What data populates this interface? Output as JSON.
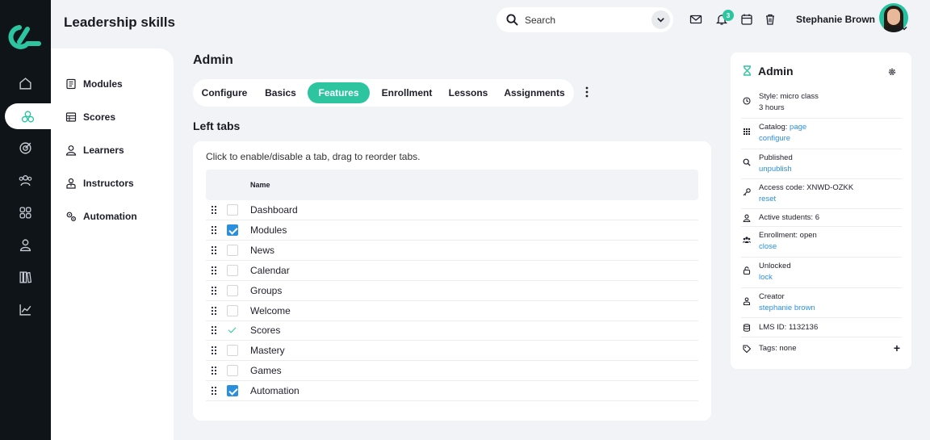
{
  "app": {
    "title": "Leadership skills"
  },
  "header": {
    "search_label": "Search",
    "notification_count": "3",
    "user_name": "Stephanie Brown"
  },
  "subnav": {
    "items": [
      {
        "label": "Modules",
        "icon": "book-icon"
      },
      {
        "label": "Scores",
        "icon": "table-icon"
      },
      {
        "label": "Learners",
        "icon": "user-icon"
      },
      {
        "label": "Instructors",
        "icon": "instructor-icon"
      },
      {
        "label": "Automation",
        "icon": "cogs-icon"
      }
    ]
  },
  "main": {
    "section_title": "Admin",
    "tabs": [
      {
        "label": "Configure"
      },
      {
        "label": "Basics"
      },
      {
        "label": "Features",
        "active": true
      },
      {
        "label": "Enrollment"
      },
      {
        "label": "Lessons"
      },
      {
        "label": "Assignments"
      }
    ],
    "left_tabs_title": "Left tabs",
    "hint": "Click to enable/disable a tab, drag to reorder tabs.",
    "column_header": "Name",
    "rows": [
      {
        "name": "Dashboard",
        "state": "off"
      },
      {
        "name": "Modules",
        "state": "on"
      },
      {
        "name": "News",
        "state": "off"
      },
      {
        "name": "Calendar",
        "state": "off"
      },
      {
        "name": "Groups",
        "state": "off"
      },
      {
        "name": "Welcome",
        "state": "off"
      },
      {
        "name": "Scores",
        "state": "tick"
      },
      {
        "name": "Mastery",
        "state": "off"
      },
      {
        "name": "Games",
        "state": "off"
      },
      {
        "name": "Automation",
        "state": "on"
      }
    ]
  },
  "card": {
    "title": "Admin",
    "props": [
      {
        "icon": "clock-icon",
        "line1": "Style: micro class",
        "line2": "3 hours"
      },
      {
        "icon": "grid-icon",
        "line1": "Catalog: ",
        "line1_link": "page",
        "line2_link": "configure"
      },
      {
        "icon": "search-icon",
        "line1": "Published",
        "line2_link": "unpublish"
      },
      {
        "icon": "key-icon",
        "line1": "Access code: XNWD-OZKK",
        "line2_link": "reset"
      },
      {
        "icon": "user-icon",
        "line1": "Active students: 6"
      },
      {
        "icon": "group-icon",
        "line1": "Enrollment: open",
        "line2_link": "close"
      },
      {
        "icon": "unlock-icon",
        "line1": "Unlocked",
        "line2_link": "lock"
      },
      {
        "icon": "creator-icon",
        "line1": "Creator",
        "line2_link": "stephanie brown"
      },
      {
        "icon": "database-icon",
        "line1": "LMS ID: 1132136"
      },
      {
        "icon": "tag-icon",
        "line1": "Tags: none",
        "action": "+"
      }
    ]
  },
  "colors": {
    "accent": "#2cc5a0",
    "link": "#2b8fe0",
    "rail": "#0f1419"
  }
}
